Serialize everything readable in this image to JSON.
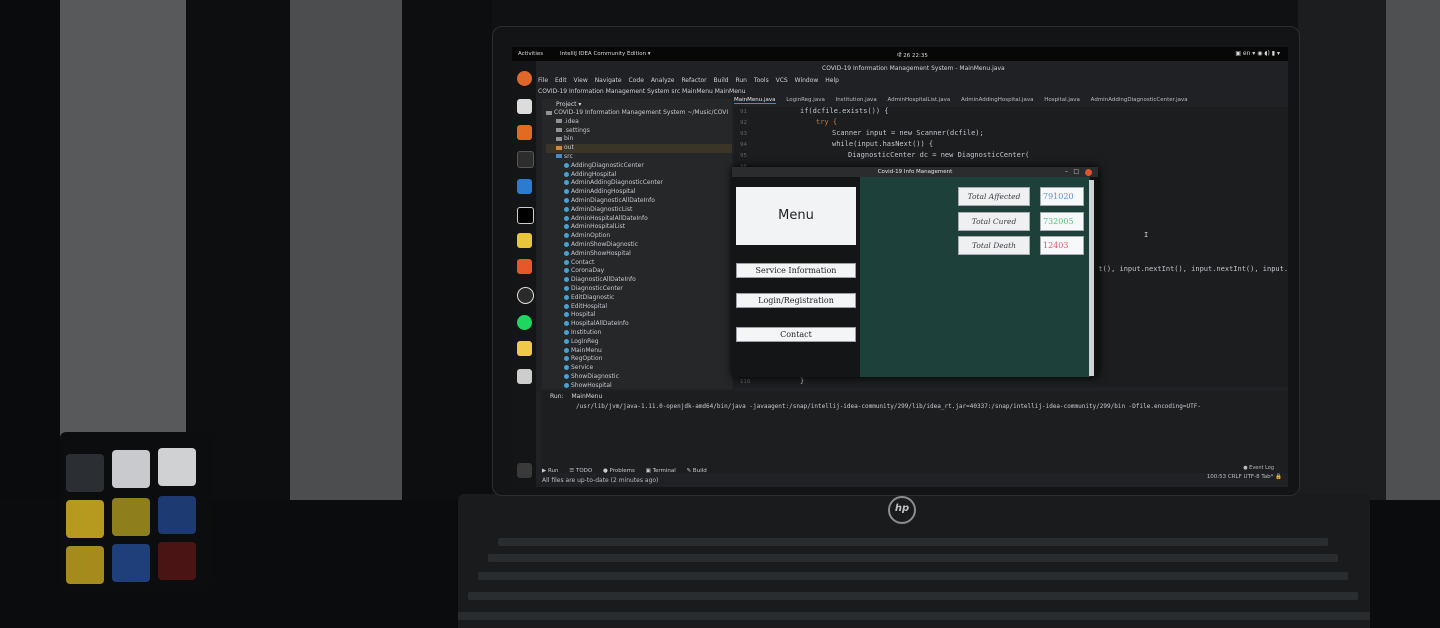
{
  "topbar": {
    "activities": "Activities",
    "app_name": "IntelliJ IDEA Community Edition ▾",
    "clock": "पौ 26  22:35",
    "indicators": "▣  en ▾   ◉  ◖)  ▮ ▾"
  },
  "ide": {
    "window_title": "COVID-19 Information Management System - MainMenu.java",
    "menu": [
      "File",
      "Edit",
      "View",
      "Navigate",
      "Code",
      "Analyze",
      "Refactor",
      "Build",
      "Run",
      "Tools",
      "VCS",
      "Window",
      "Help"
    ],
    "breadcrumb": "COVID-19 Information Management System   src   MainMenu   MainMenu",
    "project_header": "Project ▾",
    "project_root": "COVID-19 Information Management System  ~/Music/COVI",
    "folders": [
      ".idea",
      ".settings",
      "bin",
      "out",
      "src"
    ],
    "classes": [
      "AddingDiagnosticCenter",
      "AddingHospital",
      "AdminAddingDiagnosticCenter",
      "AdminAddingHospital",
      "AdminDiagnosticAllDateInfo",
      "AdminDiagnosticList",
      "AdminHospitalAllDateInfo",
      "AdminHospitalList",
      "AdminOption",
      "AdminShowDiagnostic",
      "AdminShowHospital",
      "Contact",
      "CoronaDay",
      "DiagnosticAllDateInfo",
      "DiagnosticCenter",
      "EditDiagnostic",
      "EditHospital",
      "Hospital",
      "HospitalAllDateInfo",
      "Institution",
      "LoginReg",
      "MainMenu",
      "RegOption",
      "Service",
      "ShowDiagnostic",
      "ShowHospital"
    ],
    "tabs": [
      "MainMenu.java",
      "LoginReg.java",
      "Institution.java",
      "AdminHospitalList.java",
      "AdminAddingHospital.java",
      "Hospital.java",
      "AdminAddingDiagnosticCenter.java"
    ],
    "line_numbers": [
      "91",
      "92",
      "93",
      "94",
      "95",
      "96",
      "97"
    ],
    "code_lines": [
      "if(dcfile.exists()) {",
      "try {",
      "Scanner input = new Scanner(dcfile);",
      "while(input.hasNext()) {",
      "DiagnosticCenter dc = new DiagnosticCenter(",
      "",
      "Int(), input.nextInt(), input.nextInt(), input.ne"
    ],
    "last_line_number": "116",
    "last_line_code": "}",
    "run_label": "Run:",
    "run_tab": "MainMenu",
    "run_command": "/usr/lib/jvm/java-1.11.0-openjdk-amd64/bin/java -javaagent:/snap/intellij-idea-community/299/lib/idea_rt.jar=40337:/snap/intellij-idea-community/299/bin -Dfile.encoding=UTF-",
    "bottom_tabs": [
      "▶ Run",
      "☰ TODO",
      "● Problems",
      "▣ Terminal",
      "✎ Build"
    ],
    "status": "All files are up-to-date (2 minutes ago)",
    "status_right": "100:53  CRLF  UTF-8  Tab*  🔒",
    "event_log": "● Event Log"
  },
  "covid_app": {
    "title": "Covid-19 Info Management",
    "menu_label": "Menu",
    "buttons": [
      "Service Information",
      "Login/Registration",
      "Contact"
    ],
    "stats": [
      {
        "label": "Total Affected",
        "value": "791020",
        "color": "#5a8fd8"
      },
      {
        "label": "Total Cured",
        "value": "732005",
        "color": "#57c27a"
      },
      {
        "label": "Total Death",
        "value": "12403",
        "color": "#e0566a"
      }
    ]
  },
  "laptop": {
    "brand": "hp"
  }
}
